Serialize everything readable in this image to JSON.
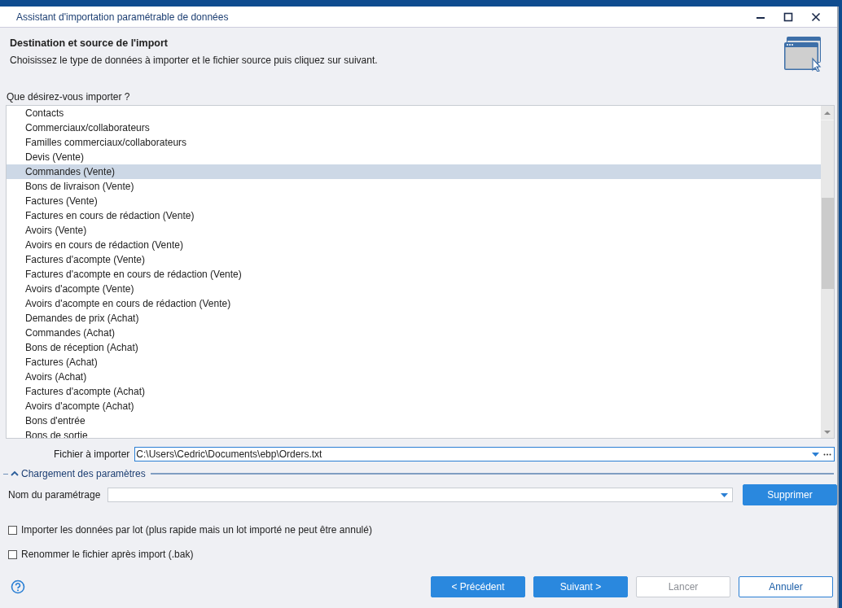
{
  "window": {
    "title": "Assistant d'importation paramétrable de données"
  },
  "header": {
    "title": "Destination et source de l'import",
    "subtitle": "Choisissez le type de données à importer et le fichier source puis cliquez sur suivant."
  },
  "import_list": {
    "label": "Que désirez-vous importer ?",
    "items": [
      {
        "label": "Contacts",
        "selected": false
      },
      {
        "label": "Commerciaux/collaborateurs",
        "selected": false
      },
      {
        "label": "Familles commerciaux/collaborateurs",
        "selected": false
      },
      {
        "label": "Devis (Vente)",
        "selected": false
      },
      {
        "label": "Commandes (Vente)",
        "selected": true
      },
      {
        "label": "Bons de livraison (Vente)",
        "selected": false
      },
      {
        "label": "Factures (Vente)",
        "selected": false
      },
      {
        "label": "Factures en cours de rédaction (Vente)",
        "selected": false
      },
      {
        "label": "Avoirs (Vente)",
        "selected": false
      },
      {
        "label": "Avoirs en cours de rédaction (Vente)",
        "selected": false
      },
      {
        "label": "Factures d'acompte (Vente)",
        "selected": false
      },
      {
        "label": "Factures d'acompte en cours de rédaction (Vente)",
        "selected": false
      },
      {
        "label": "Avoirs d'acompte (Vente)",
        "selected": false
      },
      {
        "label": "Avoirs d'acompte en cours de rédaction (Vente)",
        "selected": false
      },
      {
        "label": "Demandes de prix (Achat)",
        "selected": false
      },
      {
        "label": "Commandes (Achat)",
        "selected": false
      },
      {
        "label": "Bons de réception (Achat)",
        "selected": false
      },
      {
        "label": "Factures (Achat)",
        "selected": false
      },
      {
        "label": "Avoirs (Achat)",
        "selected": false
      },
      {
        "label": "Factures d'acompte (Achat)",
        "selected": false
      },
      {
        "label": "Avoirs d'acompte (Achat)",
        "selected": false
      },
      {
        "label": "Bons d'entrée",
        "selected": false
      },
      {
        "label": "Bons de sortie",
        "selected": false
      }
    ]
  },
  "file_field": {
    "label": "Fichier à importer",
    "value": "C:\\Users\\Cedric\\Documents\\ebp\\Orders.txt"
  },
  "parameters_section": {
    "title": "Chargement des paramètres",
    "expanded": true,
    "name_label": "Nom du paramétrage",
    "delete_button": "Supprimer"
  },
  "options": [
    {
      "label": "Importer les données par lot (plus rapide mais un lot importé ne peut être annulé)",
      "checked": false
    },
    {
      "label": "Renommer le fichier après import (.bak)",
      "checked": false
    }
  ],
  "buttons": [
    {
      "label": "< Précédent",
      "kind": "primary",
      "disabled": false
    },
    {
      "label": "Suivant >",
      "kind": "primary",
      "disabled": false
    },
    {
      "label": "Lancer",
      "kind": "secondary",
      "disabled": true
    },
    {
      "label": "Annuler",
      "kind": "secondary",
      "disabled": false
    }
  ]
}
